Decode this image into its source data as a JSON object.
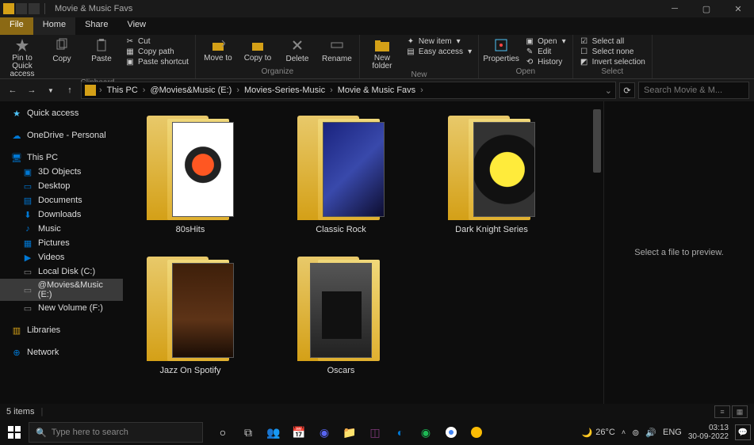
{
  "window": {
    "title": "Movie & Music Favs"
  },
  "tabs": {
    "file": "File",
    "home": "Home",
    "share": "Share",
    "view": "View"
  },
  "ribbon": {
    "clipboard": {
      "label": "Clipboard",
      "pin": "Pin to Quick access",
      "copy": "Copy",
      "paste": "Paste",
      "cut": "Cut",
      "copy_path": "Copy path",
      "paste_shortcut": "Paste shortcut"
    },
    "organize": {
      "label": "Organize",
      "move_to": "Move to",
      "copy_to": "Copy to",
      "delete": "Delete",
      "rename": "Rename"
    },
    "new": {
      "label": "New",
      "new_folder": "New folder",
      "new_item": "New item",
      "easy_access": "Easy access"
    },
    "open": {
      "label": "Open",
      "properties": "Properties",
      "open": "Open",
      "edit": "Edit",
      "history": "History"
    },
    "select": {
      "label": "Select",
      "select_all": "Select all",
      "select_none": "Select none",
      "invert": "Invert selection"
    }
  },
  "breadcrumb": {
    "items": [
      "This PC",
      "@Movies&Music (E:)",
      "Movies-Series-Music",
      "Movie & Music Favs"
    ]
  },
  "search": {
    "placeholder": "Search Movie & M..."
  },
  "sidebar": {
    "quick_access": "Quick access",
    "onedrive": "OneDrive - Personal",
    "this_pc": "This PC",
    "objects3d": "3D Objects",
    "desktop": "Desktop",
    "documents": "Documents",
    "downloads": "Downloads",
    "music": "Music",
    "pictures": "Pictures",
    "videos": "Videos",
    "local_c": "Local Disk (C:)",
    "drive_e": "@Movies&Music (E:)",
    "drive_f": "New Volume (F:)",
    "libraries": "Libraries",
    "network": "Network"
  },
  "folders": {
    "items": [
      {
        "name": "80sHits",
        "preview": "fp1"
      },
      {
        "name": "Classic Rock",
        "preview": "fp2"
      },
      {
        "name": "Dark Knight Series",
        "preview": "fp3"
      },
      {
        "name": "Jazz On Spotify",
        "preview": "fp4"
      },
      {
        "name": "Oscars",
        "preview": "fp5"
      }
    ]
  },
  "preview_pane": {
    "message": "Select a file to preview."
  },
  "status": {
    "count": "5 items"
  },
  "taskbar": {
    "search_placeholder": "Type here to search",
    "weather": "26°C",
    "lang": "ENG",
    "time": "03:13",
    "date": "30-09-2022"
  }
}
